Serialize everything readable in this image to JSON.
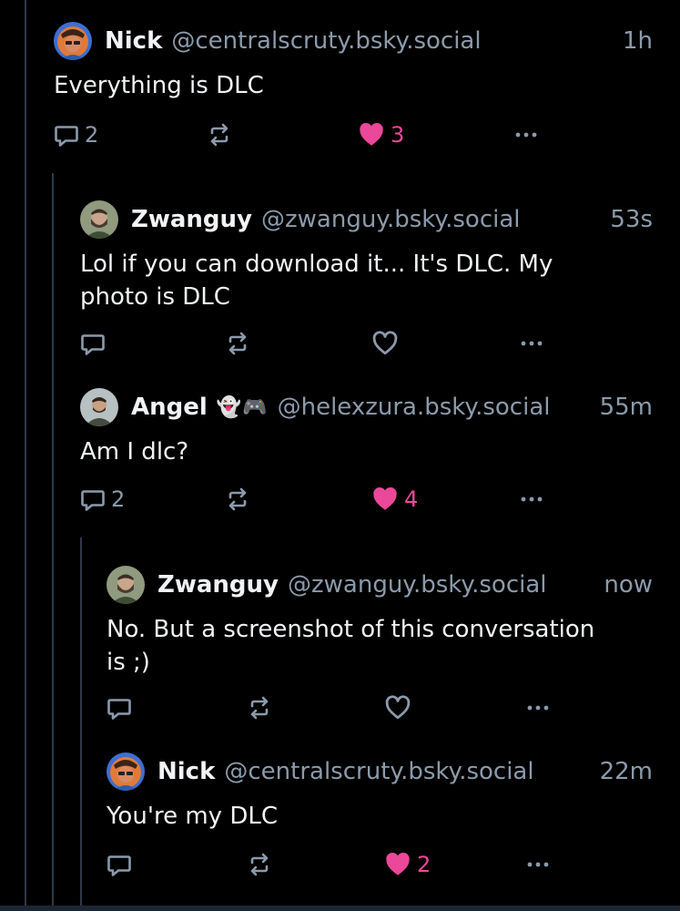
{
  "colors": {
    "background": "#000000",
    "text": "#f1f3f5",
    "muted": "#8c9aab",
    "like": "#ec4899",
    "thread_line": "#2e3a48"
  },
  "posts": [
    {
      "name": "Nick",
      "handle": "@centralscruty.bsky.social",
      "time": "1h",
      "text": "Everything is DLC",
      "reply_count": "2",
      "like_count": "3",
      "liked": true,
      "avatar_icon": "avatar-illustrated-man-icon"
    },
    {
      "name": "Zwanguy",
      "handle": "@zwanguy.bsky.social",
      "time": "53s",
      "text_lines": [
        "Lol if you can download it... It's DLC. My",
        "photo is DLC"
      ],
      "reply_count": "",
      "like_count": "",
      "liked": false,
      "avatar_icon": "avatar-bearded-man-icon"
    },
    {
      "name": "Angel",
      "emoji": "👻🎮",
      "handle": "@helexzura.bsky.social",
      "time": "55m",
      "text": "Am I dlc?",
      "reply_count": "2",
      "like_count": "4",
      "liked": true,
      "avatar_icon": "avatar-man-photo-icon"
    },
    {
      "name": "Zwanguy",
      "handle": "@zwanguy.bsky.social",
      "time": "now",
      "text_lines": [
        "No. But a screenshot of this conversation",
        "is ;)"
      ],
      "reply_count": "",
      "like_count": "",
      "liked": false,
      "avatar_icon": "avatar-bearded-man-icon"
    },
    {
      "name": "Nick",
      "handle": "@centralscruty.bsky.social",
      "time": "22m",
      "text": "You're my DLC",
      "reply_count": "",
      "like_count": "2",
      "liked": true,
      "avatar_icon": "avatar-illustrated-man-icon"
    }
  ]
}
